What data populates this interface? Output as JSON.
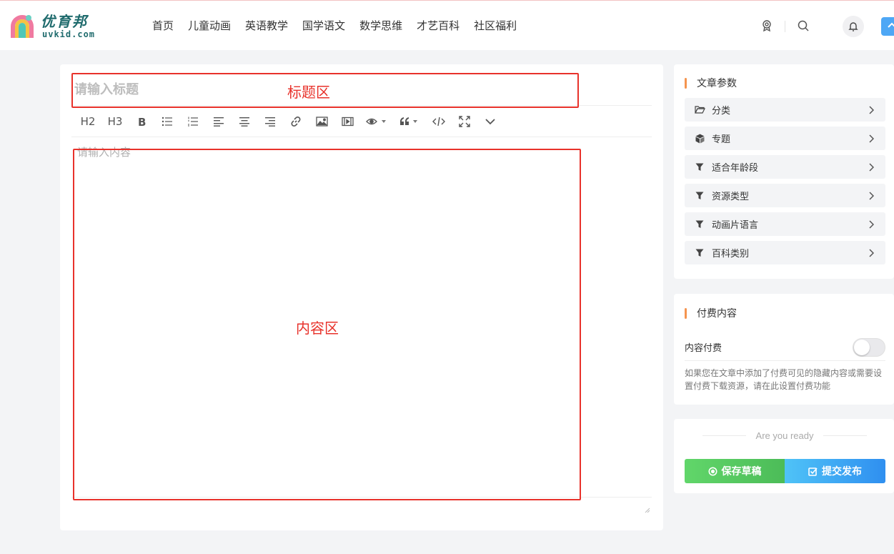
{
  "brand": {
    "name": "优育邦",
    "domain": "uvkid.com"
  },
  "nav": [
    "首页",
    "儿童动画",
    "英语教学",
    "国学语文",
    "数学思维",
    "才艺百科",
    "社区福利"
  ],
  "header_icons": [
    "badge-icon",
    "search-icon",
    "bell-icon",
    "upload-icon"
  ],
  "editor": {
    "title_placeholder": "请输入标题",
    "content_placeholder": "请输入内容",
    "toolbar": {
      "h2": "H2",
      "h3": "H3",
      "tools": [
        "bold-icon",
        "bullet-list-icon",
        "numbered-list-icon",
        "align-left-icon",
        "align-center-icon",
        "align-right-icon",
        "link-icon",
        "image-icon",
        "video-icon",
        "preview-icon",
        "quote-icon",
        "code-icon",
        "fullscreen-icon",
        "more-icon"
      ]
    },
    "annotations": {
      "title_area": "标题区",
      "content_area": "内容区"
    }
  },
  "params_panel": {
    "title": "文章参数",
    "items": [
      {
        "label": "分类",
        "icon": "folder-icon"
      },
      {
        "label": "专题",
        "icon": "cube-icon"
      },
      {
        "label": "适合年龄段",
        "icon": "filter-icon"
      },
      {
        "label": "资源类型",
        "icon": "filter-icon"
      },
      {
        "label": "动画片语言",
        "icon": "filter-icon"
      },
      {
        "label": "百科类别",
        "icon": "filter-icon"
      }
    ]
  },
  "pay_panel": {
    "title": "付费内容",
    "toggle_label": "内容付费",
    "toggle_on": false,
    "description": "如果您在文章中添加了付费可见的隐藏内容或需要设置付费下载资源，请在此设置付费功能"
  },
  "publish_panel": {
    "ready_text": "Are you ready",
    "draft_label": "保存草稿",
    "submit_label": "提交发布"
  },
  "colors": {
    "accent_orange": "#f5944f",
    "annotation_red": "#e8322b",
    "draft_green": "#52c45e",
    "submit_blue": "#3a9bf2",
    "brand_teal": "#1f6b6d"
  }
}
